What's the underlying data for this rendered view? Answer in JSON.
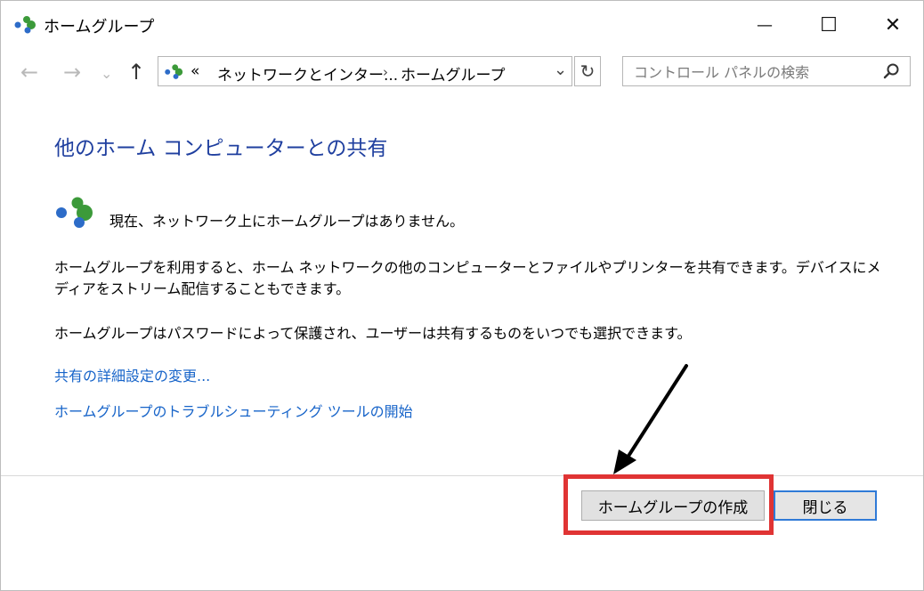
{
  "window": {
    "title": "ホームグループ",
    "minimize_glyph": "—",
    "maximize_glyph": "☐",
    "close_glyph": "✕"
  },
  "nav": {
    "back_glyph": "←",
    "forward_glyph": "→",
    "recent_glyph": "⌄",
    "up_glyph": "↑",
    "address": {
      "prefix": "«",
      "segments": [
        "ネットワークとインター...",
        "ホームグループ"
      ],
      "separator": "›",
      "dropdown_glyph": "⌄"
    },
    "refresh_glyph": "↻",
    "search_placeholder": "コントロール パネルの検索"
  },
  "content": {
    "heading": "他のホーム コンピューターとの共有",
    "status": "現在、ネットワーク上にホームグループはありません。",
    "paragraph1": "ホームグループを利用すると、ホーム ネットワークの他のコンピューターとファイルやプリンターを共有できます。デバイスにメディアをストリーム配信することもできます。",
    "paragraph2": "ホームグループはパスワードによって保護され、ユーザーは共有するものをいつでも選択できます。",
    "links": [
      "共有の詳細設定の変更...",
      "ホームグループのトラブルシューティング ツールの開始"
    ]
  },
  "footer": {
    "create_button": "ホームグループの作成",
    "close_button": "閉じる"
  },
  "colors": {
    "heading": "#1f3f9f",
    "link": "#1764c9",
    "highlight": "#e03434",
    "homegroup_green": "#3c9a3a",
    "homegroup_blue": "#2d6cc8"
  }
}
